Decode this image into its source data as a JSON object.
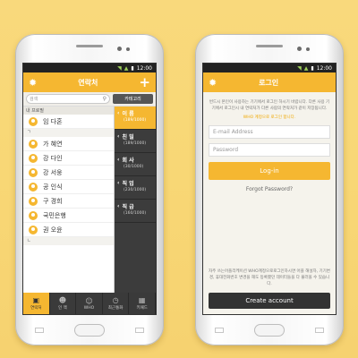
{
  "status": {
    "time": "12:00"
  },
  "contacts_screen": {
    "title": "연락처",
    "search_placeholder": "검색",
    "category_button": "카테고리",
    "profile_section": "내 프로필",
    "my_name": "임 다혼",
    "group_letter": "ㄱ",
    "contacts": [
      "가 혜연",
      "강 다인",
      "강 서웅",
      "공 인식",
      "구 경희",
      "국민은행",
      "권 오윤"
    ],
    "end_letter": "ㄴ",
    "groups": [
      {
        "name": "이 름",
        "count": "(189/1000)",
        "active": true
      },
      {
        "name": "친 밀",
        "count": "(189/1000)",
        "active": false
      },
      {
        "name": "회 사",
        "count": "(30/1000)",
        "active": false
      },
      {
        "name": "직 업",
        "count": "(230/1000)",
        "active": false
      },
      {
        "name": "직 급",
        "count": "(160/1000)",
        "active": false
      }
    ],
    "tabs": [
      "연락처",
      "인 맥",
      "WHO",
      "최근통화",
      "키패드"
    ]
  },
  "login_screen": {
    "title": "로그인",
    "info": "번드시 본인이 사용하는 기기에서 로그인 하시기 바랍니다. 다른 사용 기기에서 로그인시 내 연락처가 다른 사람의 연락처가 같이 저장됩니다.",
    "note": "WHO 계정으로 로그인 합니다.",
    "email_placeholder": "E-mail Address",
    "password_placeholder": "Password",
    "login_button": "Log-in",
    "forgot": "Forgot Password?",
    "bottom_info": "자주 쓰는어플리케이션 WHO계정으로로그인하시면 어플 해설자, 기기변경, 휴대전화번호 변경을 해도 등록했던 데이터들을 다 불러올 수 있습니다.",
    "create_button": "Create account"
  },
  "colors": {
    "accent": "#f5b731",
    "dark": "#3c3c3c",
    "background": "#f8d775"
  }
}
